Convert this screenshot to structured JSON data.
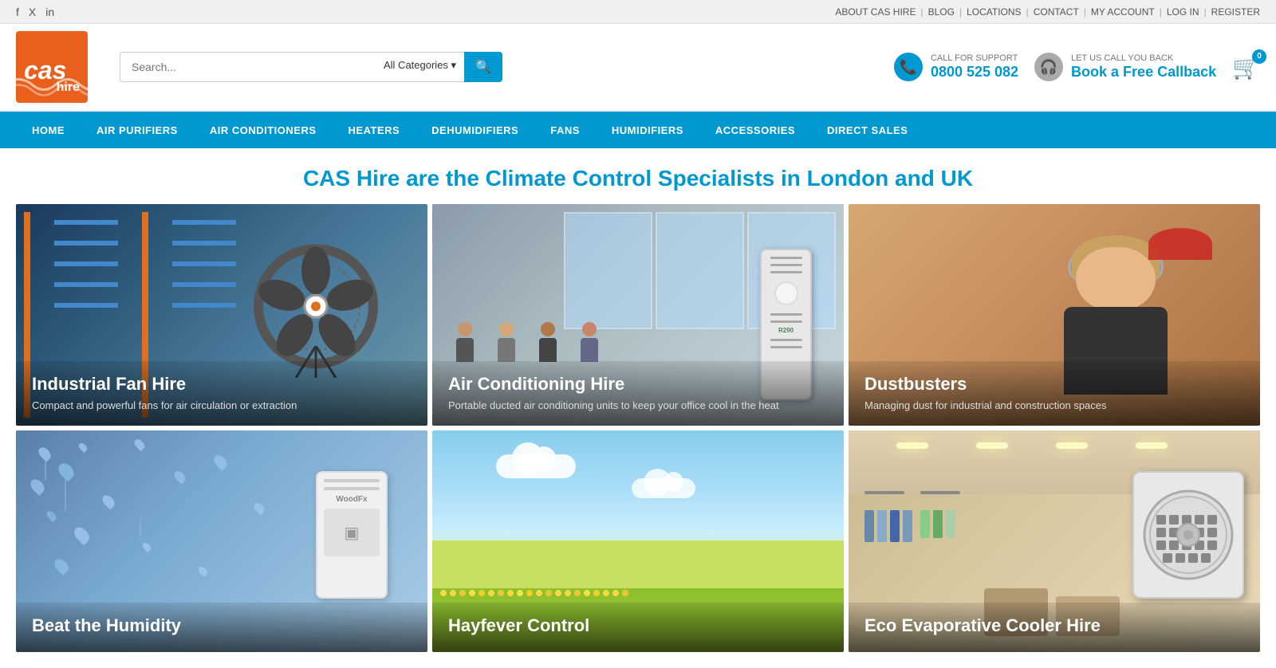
{
  "topbar": {
    "links": [
      "ABOUT CAS HIRE",
      "BLOG",
      "LOCATIONS",
      "CONTACT",
      "MY ACCOUNT",
      "LOG IN",
      "REGISTER"
    ],
    "social": [
      "facebook",
      "twitter",
      "linkedin"
    ]
  },
  "header": {
    "logo_text_top": "cas",
    "logo_text_bottom": "hire",
    "search_placeholder": "Search...",
    "search_category": "All Categories",
    "support_label": "CALL FOR SUPPORT",
    "support_number": "0800 525 082",
    "callback_label": "LET US CALL YOU BACK",
    "callback_link": "Book a Free Callback",
    "cart_count": "0"
  },
  "nav": {
    "items": [
      "HOME",
      "AIR PURIFIERS",
      "AIR CONDITIONERS",
      "HEATERS",
      "DEHUMIDIFIERS",
      "FANS",
      "HUMIDIFIERS",
      "ACCESSORIES",
      "DIRECT SALES"
    ]
  },
  "hero": {
    "title": "CAS Hire are the Climate Control Specialists in London and UK"
  },
  "grid": {
    "row1": [
      {
        "title": "Industrial Fan Hire",
        "desc": "Compact and powerful fans for air circulation or extraction",
        "type": "fan"
      },
      {
        "title": "Air Conditioning Hire",
        "desc": "Portable ducted air conditioning units to keep your office cool in the heat",
        "type": "aircon"
      },
      {
        "title": "Dustbusters",
        "desc": "Managing dust for industrial and construction spaces",
        "type": "dustbuster"
      }
    ],
    "row2": [
      {
        "title": "Beat the Humidity",
        "desc": "",
        "type": "humidity"
      },
      {
        "title": "Hayfever Control",
        "desc": "",
        "type": "hayfever"
      },
      {
        "title": "Eco Evaporative Cooler Hire",
        "desc": "",
        "type": "evaporative"
      }
    ]
  }
}
